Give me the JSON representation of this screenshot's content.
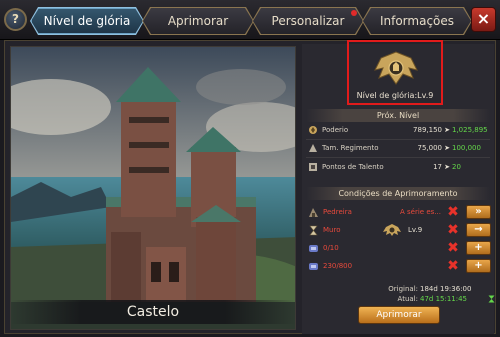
{
  "tabs": [
    {
      "label": "Nível de glória",
      "active": true
    },
    {
      "label": "Aprimorar",
      "active": false
    },
    {
      "label": "Personalizar",
      "active": false,
      "notification": true
    },
    {
      "label": "Informações",
      "active": false
    }
  ],
  "help_label": "?",
  "close_label": "×",
  "castle": {
    "name": "Castelo"
  },
  "glory": {
    "level_label": "Nível de glória:Lv.9"
  },
  "next_level": {
    "header": "Próx. Nível",
    "stats": [
      {
        "icon": "power-icon",
        "label": "Poderio",
        "current": "789,150",
        "arrow": "➤",
        "next": "1,025,895"
      },
      {
        "icon": "regiment-icon",
        "label": "Tam. Regimento",
        "current": "75,000",
        "arrow": "➤",
        "next": "100,000"
      },
      {
        "icon": "talent-icon",
        "label": "Pontos de Talento",
        "current": "17",
        "arrow": "➤",
        "next": "20"
      }
    ]
  },
  "conditions": {
    "header": "Condições de Aprimoramento",
    "items": [
      {
        "icon": "quarry-icon",
        "label": "Pedreira",
        "mid": "A série es...",
        "button": "»"
      },
      {
        "icon": "hourglass-icon",
        "label": "Muro",
        "level": "Lv.9",
        "button": "→"
      },
      {
        "icon": "resource-icon",
        "label": "0/10",
        "button": "+"
      },
      {
        "icon": "resource-icon",
        "label": "230/800",
        "button": "+"
      }
    ]
  },
  "timing": {
    "original_label": "Original:",
    "original_value": "184d 19:36:00",
    "current_label": "Atual:",
    "current_value": "47d 15:11:45"
  },
  "upgrade_button": "Aprimorar",
  "colors": {
    "accent_green": "#64d84a",
    "warning_red": "#e84a3c",
    "highlight_box": "#e21b1b",
    "button_orange": "#e9a64a"
  }
}
